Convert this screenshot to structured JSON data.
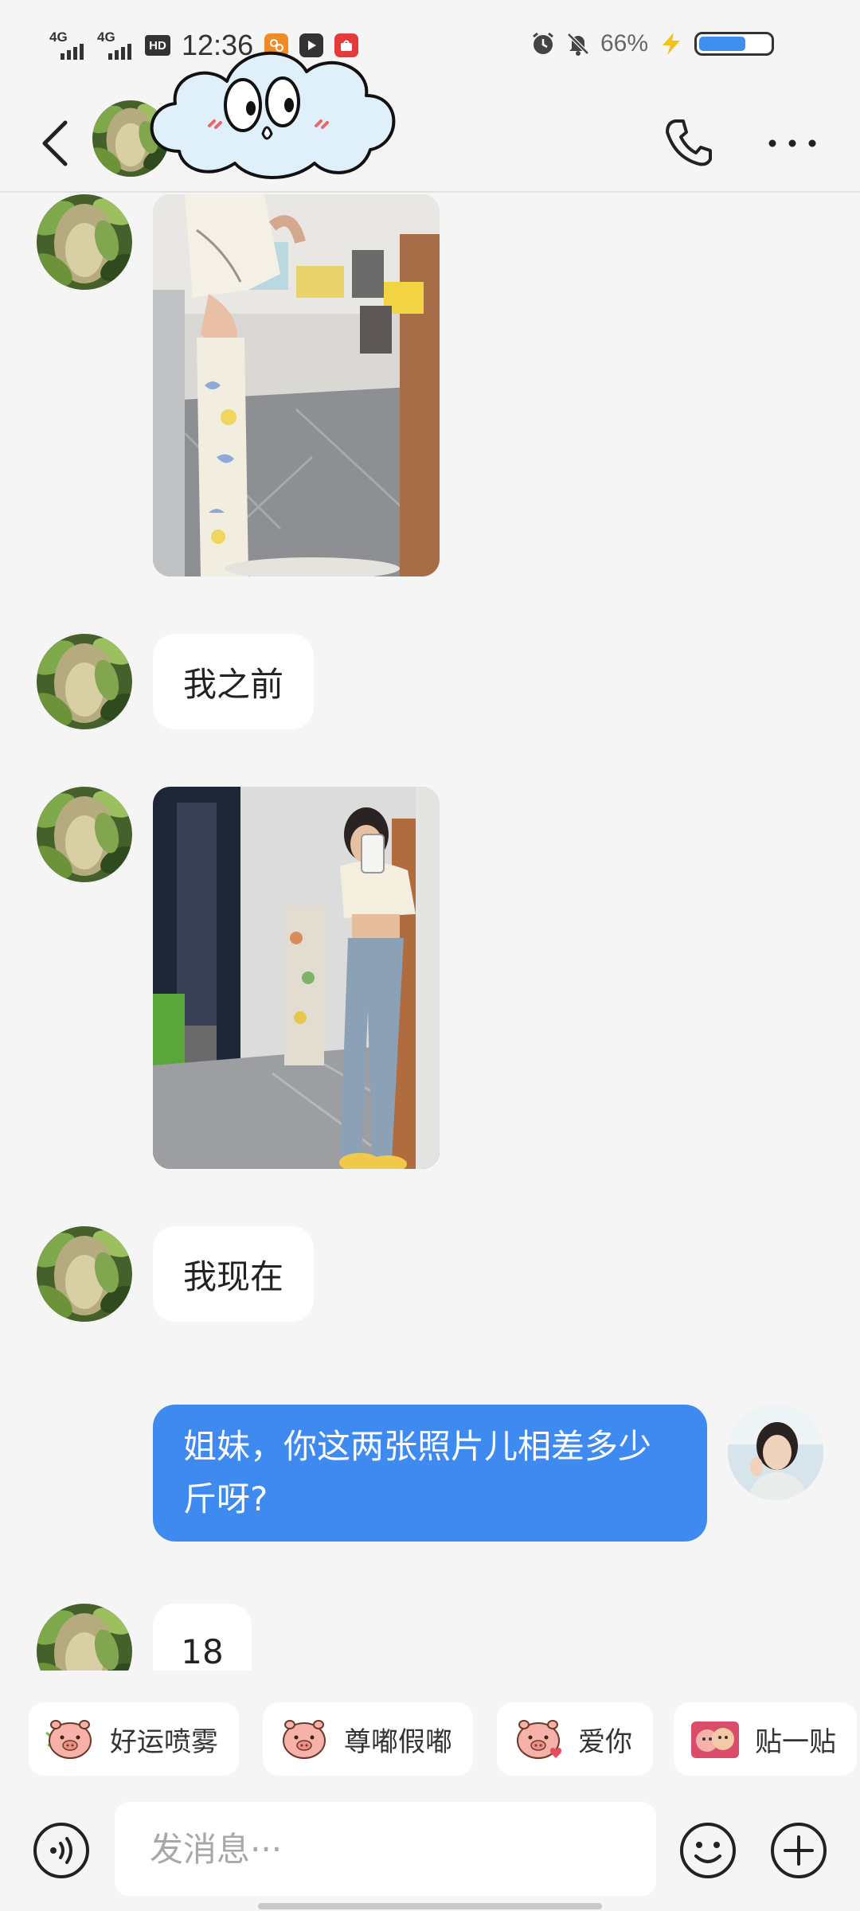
{
  "status_bar": {
    "time": "12:36",
    "network_1": "4G",
    "network_2": "4G",
    "hd_label": "HD",
    "battery_percent": "66%",
    "battery_level": 0.66,
    "icons": [
      "signal-icon",
      "hd-icon",
      "app-notification-icon",
      "video-app-icon",
      "shopping-app-icon",
      "alarm-icon",
      "mute-icon",
      "charging-icon",
      "battery-icon"
    ]
  },
  "header": {
    "icons": [
      "back-arrow-icon",
      "phone-icon",
      "more-icon"
    ],
    "sticker": "cloud-face-sticker"
  },
  "messages": [
    {
      "sender": "other",
      "type": "image",
      "image": "belly-before-photo"
    },
    {
      "sender": "other",
      "type": "text",
      "text": "我之前"
    },
    {
      "sender": "other",
      "type": "image",
      "image": "belly-after-photo"
    },
    {
      "sender": "other",
      "type": "text",
      "text": "我现在"
    },
    {
      "sender": "me",
      "type": "text",
      "text": "姐妹，你这两张照片儿相差多少斤呀?"
    },
    {
      "sender": "other",
      "type": "text",
      "text": "18"
    }
  ],
  "quick_stickers": [
    {
      "label": "好运喷雾",
      "icon": "lucky-spray-pig-icon"
    },
    {
      "label": "尊嘟假嘟",
      "icon": "really-pig-icon"
    },
    {
      "label": "爱你",
      "icon": "love-pig-icon"
    },
    {
      "label": "贴一贴",
      "icon": "cuddle-icon"
    }
  ],
  "input": {
    "placeholder": "发消息···",
    "icons": [
      "voice-icon",
      "emoji-icon",
      "plus-icon"
    ]
  },
  "colors": {
    "background": "#f5f5f5",
    "my_bubble": "#3e8af0",
    "other_bubble": "#ffffff",
    "battery_fill": "#3f8ff0"
  }
}
